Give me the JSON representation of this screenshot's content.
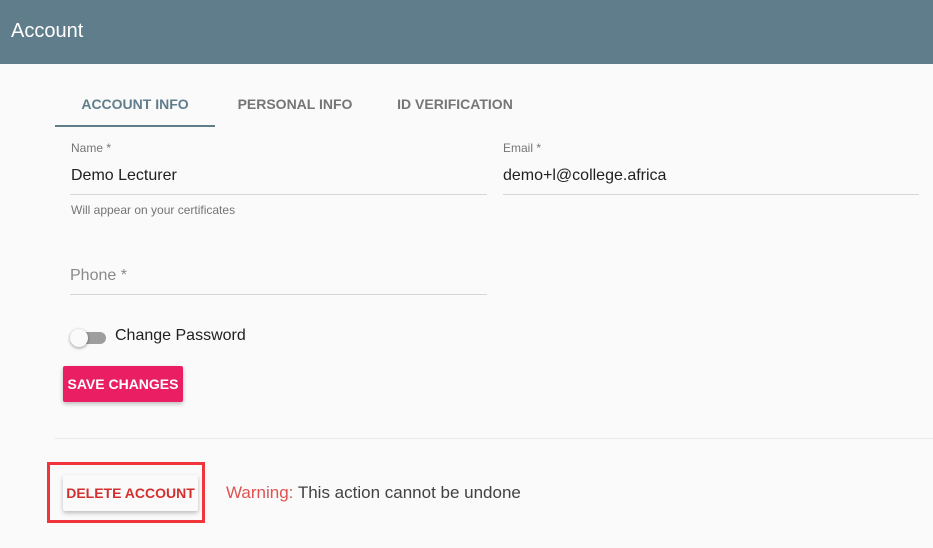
{
  "appbar": {
    "title": "Account"
  },
  "tabs": [
    {
      "label": "ACCOUNT INFO",
      "active": true
    },
    {
      "label": "PERSONAL INFO",
      "active": false
    },
    {
      "label": "ID VERIFICATION",
      "active": false
    }
  ],
  "form": {
    "name": {
      "label": "Name *",
      "value": "Demo Lecturer",
      "helper": "Will appear on your certificates"
    },
    "email": {
      "label": "Email *",
      "value": "demo+l@college.africa"
    },
    "phone": {
      "label": "Phone *",
      "value": ""
    },
    "change_password": {
      "label": "Change Password",
      "checked": false
    },
    "save_label": "SAVE CHANGES"
  },
  "danger": {
    "delete_label": "DELETE ACCOUNT",
    "warning_prefix": "Warning:",
    "warning_text": " This action cannot be undone"
  },
  "colors": {
    "primary": "#607d8b",
    "accent": "#e91e63",
    "danger": "#d32f2f",
    "highlight": "#f0363a"
  }
}
